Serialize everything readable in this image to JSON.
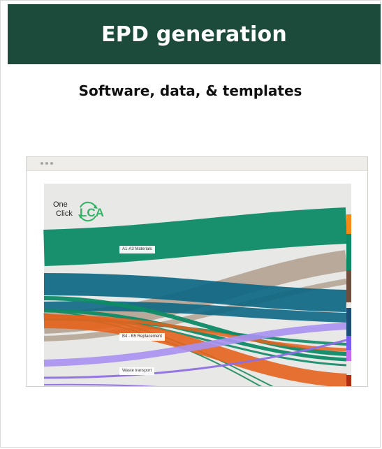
{
  "header": {
    "title": "EPD generation",
    "background": "#1d4b3b"
  },
  "subtitle": "Software, data, & templates",
  "browser": {
    "logo": {
      "word1": "One",
      "word2": "Click",
      "word3": "LCA",
      "accent": "#2fb463",
      "icon": "recycle-arrows-icon"
    },
    "flow_labels": {
      "materials": "A1-A3 Materials",
      "replacement": "B4 - B5 Replacement",
      "transport": "Waste transport"
    },
    "colors": {
      "teal": "#0d8a66",
      "petrol": "#0d6784",
      "tan": "#b3a291",
      "orange": "#e5631d",
      "lavender": "#a990f2",
      "canvas": "#e8e8e6"
    }
  }
}
